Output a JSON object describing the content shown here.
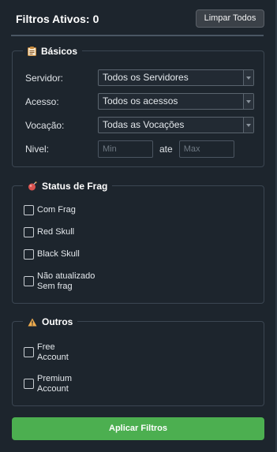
{
  "header": {
    "title": "Filtros Ativos:",
    "count": "0",
    "clear_label": "Limpar Todos"
  },
  "basicos": {
    "legend": "Básicos",
    "icon": "clipboard-icon",
    "servidor": {
      "label": "Servidor:",
      "value": "Todos os Servidores"
    },
    "acesso": {
      "label": "Acesso:",
      "value": "Todos os acessos"
    },
    "vocacao": {
      "label": "Vocação:",
      "value": "Todas as Vocações"
    },
    "nivel": {
      "label": "Nivel:",
      "min_placeholder": "Min",
      "sep": "ate",
      "max_placeholder": "Max"
    }
  },
  "frag": {
    "legend": "Status de Frag",
    "icon": "bomb-icon",
    "items": [
      {
        "label": "Com Frag",
        "checked": false
      },
      {
        "label": "Red Skull",
        "checked": false
      },
      {
        "label": "Black Skull",
        "checked": false
      },
      {
        "label": "Não atualizado Sem frag",
        "line1": "Não atualizado",
        "line2": "Sem frag",
        "checked": false
      }
    ]
  },
  "outros": {
    "legend": "Outros",
    "icon": "warning-icon",
    "items": [
      {
        "label": "Free Account",
        "line1": "Free",
        "line2": "Account",
        "checked": false
      },
      {
        "label": "Premium Account",
        "line1": "Premium",
        "line2": "Account",
        "checked": false
      }
    ]
  },
  "apply_label": "Aplicar Filtros",
  "colors": {
    "background": "#1d252d",
    "apply": "#4caf50",
    "border": "#3b4652"
  }
}
